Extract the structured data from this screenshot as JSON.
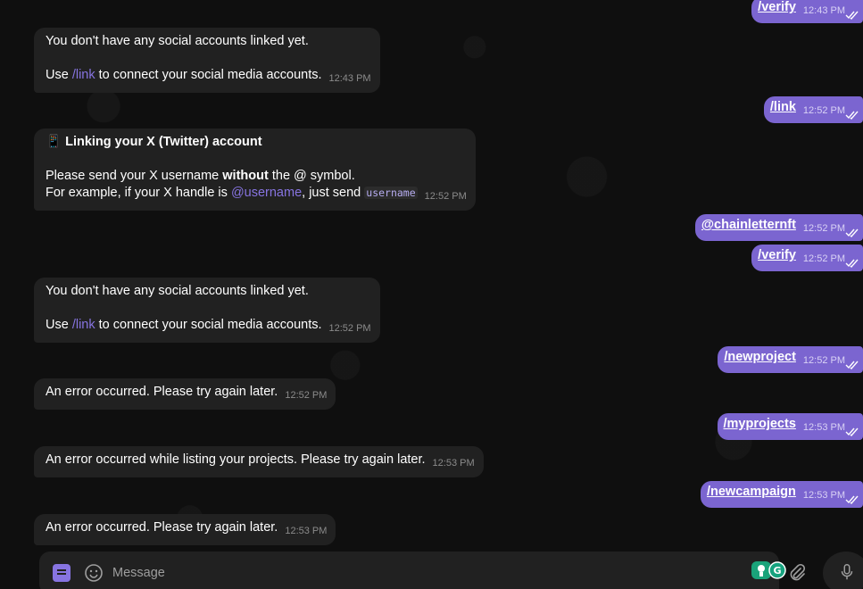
{
  "messages": {
    "out_verify_1": {
      "text": "/verify",
      "time": "12:43 PM"
    },
    "in_nolink_1": {
      "line1": "You don't have any social accounts linked yet.",
      "pre": "Use ",
      "cmd": "/link",
      "post": " to connect your social media accounts.",
      "time": "12:43 PM"
    },
    "out_link": {
      "text": "/link",
      "time": "12:52 PM"
    },
    "in_linking": {
      "emoji": "📱",
      "title": "Linking your X (Twitter) account",
      "l2_pre": "Please send your X username ",
      "l2_bold": "without",
      "l2_post": " the @ symbol.",
      "l3_pre": "For example, if your X handle is ",
      "l3_mention": "@username",
      "l3_mid": ", just send ",
      "l3_code": "username",
      "time": "12:52 PM"
    },
    "out_handle": {
      "text": "@chainletternft",
      "time": "12:52 PM"
    },
    "out_verify_2": {
      "text": "/verify",
      "time": "12:52 PM"
    },
    "in_nolink_2": {
      "line1": "You don't have any social accounts linked yet.",
      "pre": "Use ",
      "cmd": "/link",
      "post": " to connect your social media accounts.",
      "time": "12:52 PM"
    },
    "out_newproject": {
      "text": "/newproject",
      "time": "12:52 PM"
    },
    "in_error_1": {
      "text": "An error occurred. Please try again later.",
      "time": "12:52 PM"
    },
    "out_myprojects": {
      "text": "/myprojects",
      "time": "12:53 PM"
    },
    "in_error_list": {
      "text": "An error occurred while listing your projects. Please try again later.",
      "time": "12:53 PM"
    },
    "out_newcampaign": {
      "text": "/newcampaign",
      "time": "12:53 PM"
    },
    "in_error_2": {
      "text": "An error occurred. Please try again later.",
      "time": "12:53 PM"
    }
  },
  "composer": {
    "placeholder": "Message",
    "icons": [
      "bot-menu-icon",
      "emoji-icon",
      "extension-icon",
      "attach-icon",
      "microphone-icon"
    ]
  },
  "colors": {
    "background": "#0f0f0f",
    "incoming_bubble": "#212121",
    "outgoing_bubble": "#7b65d0",
    "accent": "#8774e1"
  }
}
